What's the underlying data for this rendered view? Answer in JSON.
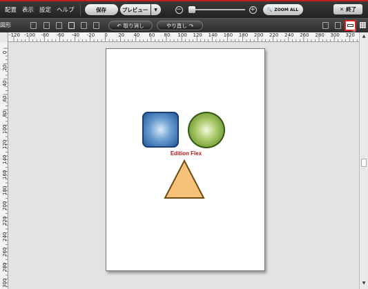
{
  "menu": {
    "items": [
      "配置",
      "表示",
      "設定",
      "ヘルプ"
    ]
  },
  "toolbar": {
    "save_label": "保存",
    "preview_label": "プレビュー",
    "preview_dropdown_icon": "chevron-down-icon",
    "zoom_out_symbol": "−",
    "zoom_in_symbol": "+",
    "zoom_level": 0,
    "zoom_all_label": "ZOOM ALL",
    "close_label": "終了",
    "close_symbol": "✕"
  },
  "toolbar2": {
    "left_label": "図形",
    "undo_label": "取り消し",
    "redo_label": "やり直し",
    "undo_icon": "undo-icon",
    "redo_icon": "redo-icon"
  },
  "ruler": {
    "h_labels": [
      "-120",
      "-100",
      "-80",
      "-60",
      "-40",
      "-20",
      "0",
      "20",
      "40",
      "60",
      "80",
      "100",
      "120",
      "140",
      "160",
      "180",
      "200",
      "220",
      "240",
      "260",
      "280",
      "300",
      "320"
    ],
    "v_labels": [
      "0",
      "20",
      "40",
      "60",
      "80",
      "100",
      "120",
      "140",
      "160",
      "180",
      "200",
      "220",
      "240",
      "260",
      "280",
      "300"
    ]
  },
  "canvas": {
    "text": "Edition Flex",
    "shapes": [
      {
        "kind": "rounded-square",
        "fill": "#2f6aa8",
        "border": "#1a3f6f"
      },
      {
        "kind": "circle",
        "fill": "#8db344",
        "border": "#32560f"
      },
      {
        "kind": "triangle",
        "fill": "#f6c27a",
        "border": "#6b4a14"
      }
    ]
  },
  "colors": {
    "accent_red": "#c41e1e",
    "text_red": "#b01818"
  }
}
